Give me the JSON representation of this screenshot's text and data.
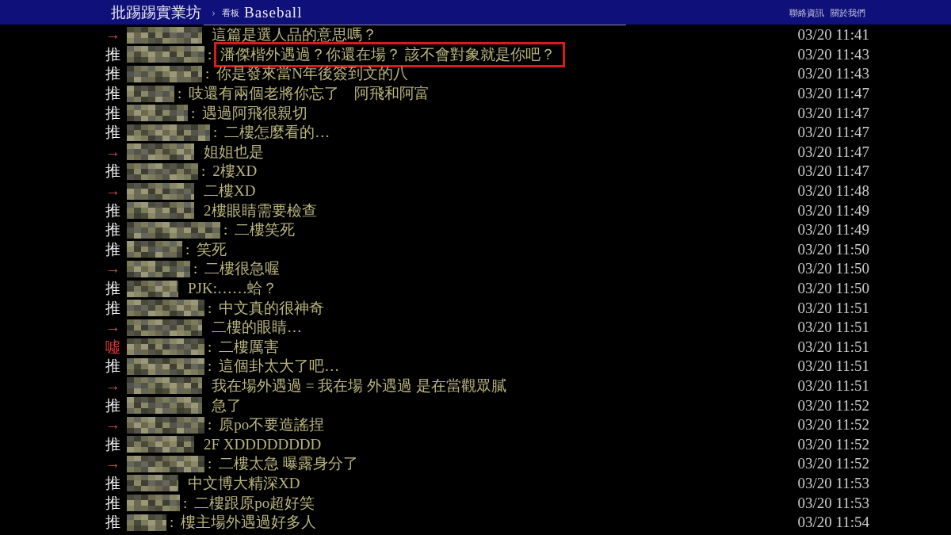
{
  "header": {
    "site_title": "批踢踢實業坊",
    "separator": "›",
    "board_label": "看板",
    "board_name": "Baseball",
    "links": [
      "聯絡資訊",
      "關於我們"
    ]
  },
  "comments": [
    {
      "kind": "arrow",
      "tag": "→",
      "content": "這篇是選人品的意思嗎？",
      "time": "03/20 11:41",
      "highlighted": false
    },
    {
      "kind": "push",
      "tag": "推",
      "colon": ":",
      "content": "潘傑楷外遇過？你還在場？ 該不會對象就是你吧？",
      "time": "03/20 11:43",
      "highlighted": true
    },
    {
      "kind": "push",
      "tag": "推",
      "colon": ":",
      "content": "你是發來當N年後簽到文的八",
      "time": "03/20 11:43",
      "highlighted": false
    },
    {
      "kind": "push",
      "tag": "推",
      "colon": ":",
      "content": "吱還有兩個老將你忘了　阿飛和阿富",
      "time": "03/20 11:47",
      "highlighted": false
    },
    {
      "kind": "push",
      "tag": "推",
      "colon": ":",
      "content": "遇過阿飛很親切",
      "time": "03/20 11:47",
      "highlighted": false
    },
    {
      "kind": "push",
      "tag": "推",
      "colon": ":",
      "content": "二樓怎麼看的…",
      "time": "03/20 11:47",
      "highlighted": false
    },
    {
      "kind": "arrow",
      "tag": "→",
      "content": "姐姐也是",
      "time": "03/20 11:47",
      "highlighted": false
    },
    {
      "kind": "push",
      "tag": "推",
      "colon": ":",
      "content": "2樓XD",
      "time": "03/20 11:47",
      "highlighted": false
    },
    {
      "kind": "arrow",
      "tag": "→",
      "content": "二樓XD",
      "time": "03/20 11:48",
      "highlighted": false
    },
    {
      "kind": "push",
      "tag": "推",
      "content": "2樓眼睛需要檢查",
      "time": "03/20 11:49",
      "highlighted": false
    },
    {
      "kind": "push",
      "tag": "推",
      "colon": ":",
      "content": "二樓笑死",
      "time": "03/20 11:49",
      "highlighted": false
    },
    {
      "kind": "push",
      "tag": "推",
      "colon": ":",
      "content": "笑死",
      "time": "03/20 11:50",
      "highlighted": false
    },
    {
      "kind": "arrow",
      "tag": "→",
      "colon": ":",
      "content": "二樓很急喔",
      "time": "03/20 11:50",
      "highlighted": false
    },
    {
      "kind": "push",
      "tag": "推",
      "content": "PJK:……蛤？",
      "time": "03/20 11:50",
      "highlighted": false
    },
    {
      "kind": "push",
      "tag": "推",
      "colon": ":",
      "content": "中文真的很神奇",
      "time": "03/20 11:51",
      "highlighted": false
    },
    {
      "kind": "arrow",
      "tag": "→",
      "content": "二樓的眼睛…",
      "time": "03/20 11:51",
      "highlighted": false
    },
    {
      "kind": "boo",
      "tag": "噓",
      "colon": ":",
      "content": "二樓厲害",
      "time": "03/20 11:51",
      "highlighted": false
    },
    {
      "kind": "push",
      "tag": "推",
      "colon": ":",
      "content": "這個卦太大了吧…",
      "time": "03/20 11:51",
      "highlighted": false
    },
    {
      "kind": "arrow",
      "tag": "→",
      "content": "我在場外遇過 = 我在場 外遇過 是在當觀眾膩",
      "time": "03/20 11:51",
      "highlighted": false
    },
    {
      "kind": "push",
      "tag": "推",
      "content": "急了",
      "time": "03/20 11:52",
      "highlighted": false
    },
    {
      "kind": "arrow",
      "tag": "→",
      "colon": ":",
      "content": "原po不要造謠捏",
      "time": "03/20 11:52",
      "highlighted": false
    },
    {
      "kind": "push",
      "tag": "推",
      "content": "2F XDDDDDDDD",
      "time": "03/20 11:52",
      "highlighted": false
    },
    {
      "kind": "arrow",
      "tag": "→",
      "colon": ":",
      "content": "二樓太急 曝露身分了",
      "time": "03/20 11:52",
      "highlighted": false
    },
    {
      "kind": "push",
      "tag": "推",
      "content": "中文博大精深XD",
      "time": "03/20 11:53",
      "highlighted": false
    },
    {
      "kind": "push",
      "tag": "推",
      "colon": ":",
      "content": "二樓跟原po超好笑",
      "time": "03/20 11:53",
      "highlighted": false
    },
    {
      "kind": "push",
      "tag": "推",
      "colon": ":",
      "content": "樓主場外遇過好多人",
      "time": "03/20 11:54",
      "highlighted": false
    }
  ]
}
